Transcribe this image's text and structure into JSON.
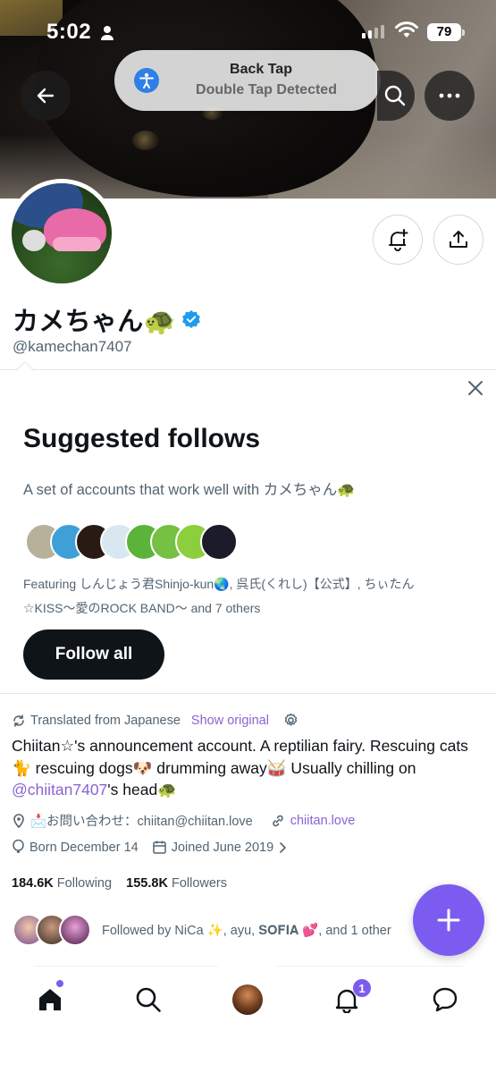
{
  "status_bar": {
    "time": "5:02",
    "battery": "79"
  },
  "back_tap": {
    "title": "Back Tap",
    "subtitle": "Double Tap Detected"
  },
  "profile": {
    "display_name": "カメちゃん🐢",
    "handle": "@kamechan7407"
  },
  "suggested": {
    "title": "Suggested follows",
    "subtitle": "A set of accounts that work well with カメちゃん🐢",
    "featuring_line1": "Featuring しんじょう君Shinjo-kun🌏, 呉氏(くれし)【公式】, ちぃたん",
    "featuring_line2": "☆KISS〜愛のROCK BAND〜 and 7 others",
    "follow_all_label": "Follow all",
    "avatar_colors": [
      "#b7b09a",
      "#3fa0d8",
      "#2a1a14",
      "#d9e7f0",
      "#5bb33a",
      "#76c043",
      "#8ccf3c",
      "#1b1b2a"
    ]
  },
  "bio": {
    "translated_label": "Translated from Japanese",
    "show_original": "Show original",
    "text_part1": "Chiitan☆'s announcement account. A reptilian fairy. Rescuing cats 🐈 rescuing dogs🐶 drumming away🥁 Usually chilling on ",
    "mention": "@chiitan7407",
    "text_part2": "'s head🐢"
  },
  "meta": {
    "location": "📩お問い合わせ：chiitan@chiitan.love",
    "link": "chiitan.love",
    "born": "Born December 14",
    "joined": "Joined June 2019"
  },
  "counts": {
    "following_count": "184.6K",
    "following_label": "Following",
    "followers_count": "155.8K",
    "followers_label": "Followers"
  },
  "followed_by": "Followed by NiCa ✨, ayu, 𝐒𝐎𝐅𝐈𝐀 💕, and 1 other",
  "tabbar": {
    "notifications_badge": "1"
  },
  "colors": {
    "accent": "#7c5cf0",
    "link": "#8a63d2"
  }
}
